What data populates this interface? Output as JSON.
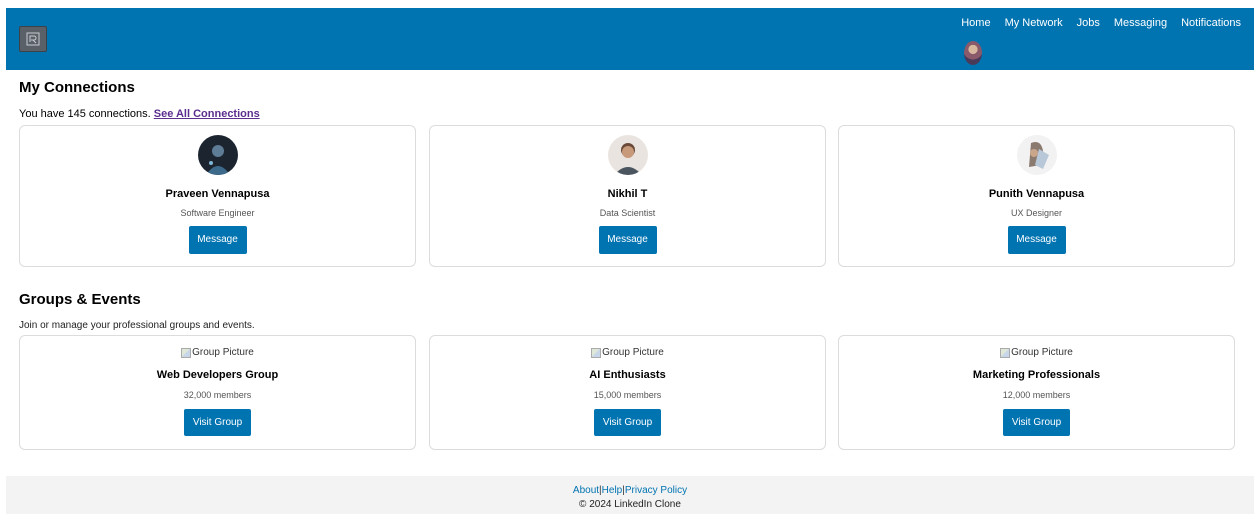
{
  "nav": {
    "items": [
      "Home",
      "My Network",
      "Jobs",
      "Messaging",
      "Notifications"
    ]
  },
  "connections": {
    "heading": "My Connections",
    "summary": "You have 145 connections.",
    "see_all": "See All Connections",
    "cards": [
      {
        "name": "Praveen Vennapusa",
        "title": "Software Engineer",
        "button": "Message"
      },
      {
        "name": "Nikhil T",
        "title": "Data Scientist",
        "button": "Message"
      },
      {
        "name": "Punith Vennapusa",
        "title": "UX Designer",
        "button": "Message"
      }
    ]
  },
  "groups": {
    "heading": "Groups & Events",
    "summary": "Join or manage your professional groups and events.",
    "cards": [
      {
        "image_alt": "Group Picture",
        "name": "Web Developers Group",
        "members": "32,000 members",
        "button": "Visit Group"
      },
      {
        "image_alt": "Group Picture",
        "name": "AI Enthusiasts",
        "members": "15,000 members",
        "button": "Visit Group"
      },
      {
        "image_alt": "Group Picture",
        "name": "Marketing Professionals",
        "members": "12,000 members",
        "button": "Visit Group"
      }
    ]
  },
  "footer": {
    "links": [
      "About",
      "Help",
      "Privacy Policy"
    ],
    "separator": "|",
    "copyright": "© 2024 LinkedIn Clone"
  },
  "colors": {
    "brand": "#0073b1",
    "link_visited": "#5b2d8e",
    "footer_bg": "#f3f3f3"
  }
}
